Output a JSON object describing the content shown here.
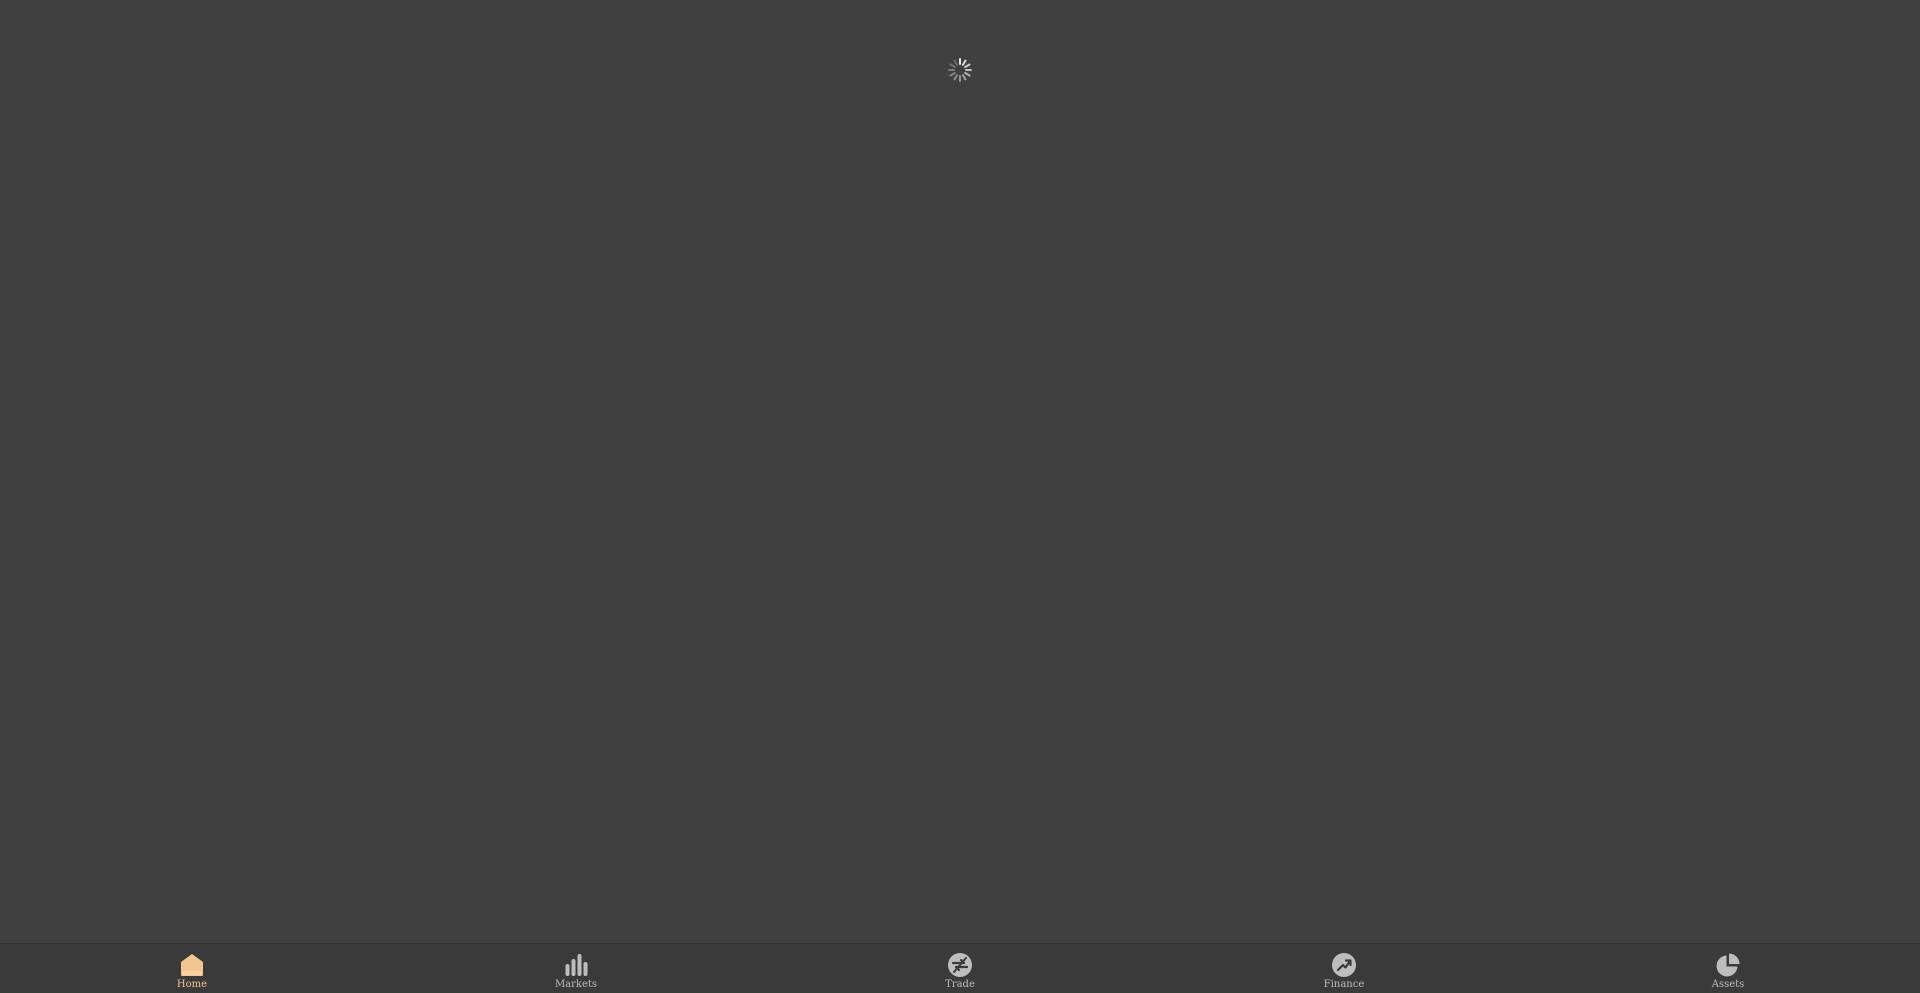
{
  "colors": {
    "background": "#404040",
    "tabbar_background": "#3a3a3a",
    "active": "#f3c58e",
    "inactive": "#bdbdbd"
  },
  "loading": {
    "icon": "loading-spinner-icon"
  },
  "tabbar": {
    "tabs": [
      {
        "label": "Home",
        "icon": "home-icon",
        "active": true
      },
      {
        "label": "Markets",
        "icon": "bar-chart-icon",
        "active": false
      },
      {
        "label": "Trade",
        "icon": "trade-icon",
        "active": false
      },
      {
        "label": "Finance",
        "icon": "finance-icon",
        "active": false
      },
      {
        "label": "Assets",
        "icon": "pie-chart-icon",
        "active": false
      }
    ]
  }
}
